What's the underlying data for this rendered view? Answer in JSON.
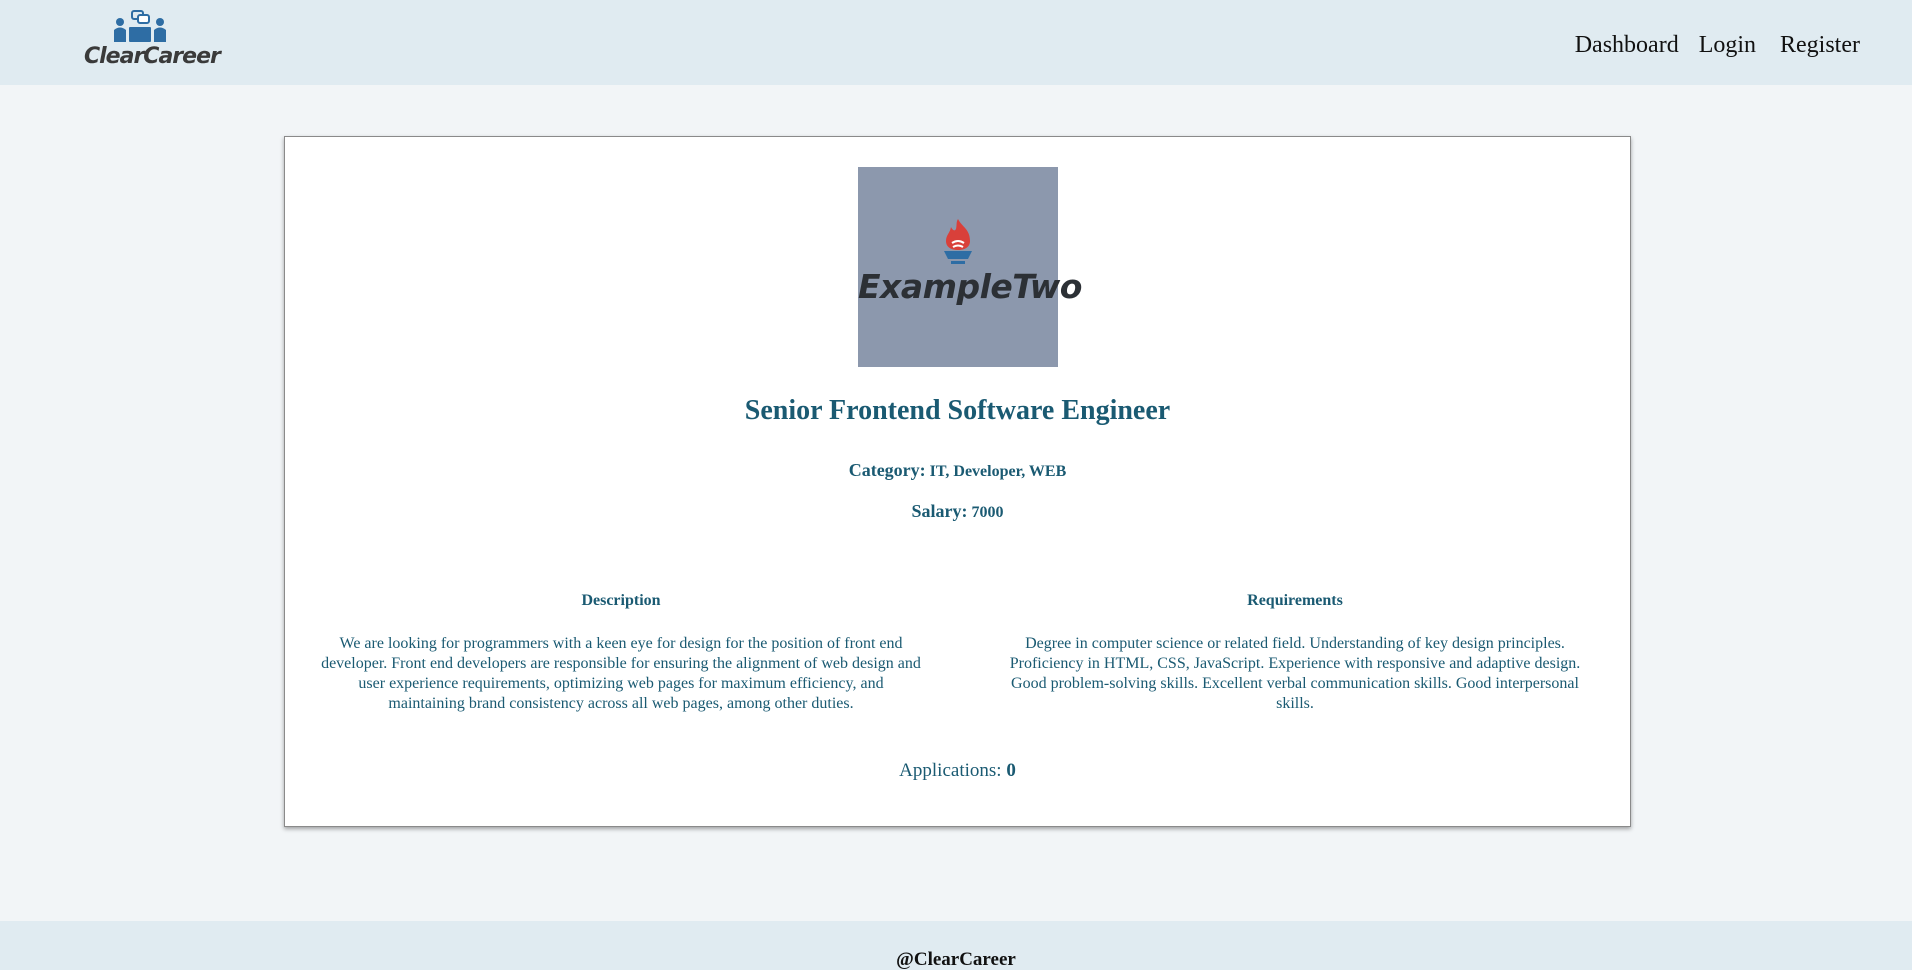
{
  "header": {
    "logo_text": "ClearCareer",
    "nav": {
      "dashboard": "Dashboard",
      "login": "Login",
      "register": "Register"
    }
  },
  "job": {
    "company_logo_text": "ExampleTwo",
    "title": "Senior Frontend Software Engineer",
    "category_label": "Category:",
    "category_value": "IT, Developer, WEB",
    "salary_label": "Salary:",
    "salary_value": "7000",
    "description_heading": "Description",
    "description": "We are looking for programmers with a keen eye for design for the position of front end developer. Front end developers are responsible for ensuring the alignment of web design and user experience requirements, optimizing web pages for maximum efficiency, and maintaining brand consistency across all web pages, among other duties.",
    "requirements_heading": "Requirements",
    "requirements": "Degree in computer science or related field. Understanding of key design principles. Proficiency in HTML, CSS, JavaScript. Experience with responsive and adaptive design. Good problem-solving skills. Excellent verbal communication skills. Good interpersonal skills.",
    "applications_label": "Applications:",
    "applications_count": "0"
  },
  "footer": {
    "text": "@ClearCareer"
  },
  "colors": {
    "header_bg": "#e0ebf1",
    "page_bg": "#f2f5f7",
    "accent_text": "#1a5a72",
    "logo_tile_bg": "#8c98ad",
    "flame_red": "#d9403a",
    "brand_blue": "#2e6da4"
  }
}
